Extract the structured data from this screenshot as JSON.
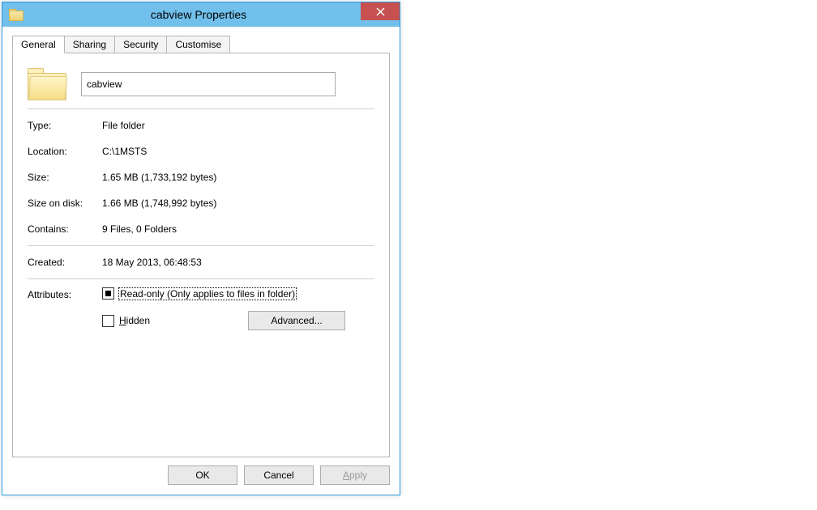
{
  "window": {
    "title": "cabview Properties"
  },
  "tabs": {
    "general": "General",
    "sharing": "Sharing",
    "security": "Security",
    "customise": "Customise"
  },
  "name_field": {
    "value": "cabview"
  },
  "props": {
    "type_label": "Type:",
    "type_value": "File folder",
    "location_label": "Location:",
    "location_value": "C:\\1MSTS",
    "size_label": "Size:",
    "size_value": "1.65 MB (1,733,192 bytes)",
    "sizeondisk_label": "Size on disk:",
    "sizeondisk_value": "1.66 MB (1,748,992 bytes)",
    "contains_label": "Contains:",
    "contains_value": "9 Files, 0 Folders",
    "created_label": "Created:",
    "created_value": "18 May 2013, 06:48:53",
    "attributes_label": "Attributes:"
  },
  "attributes": {
    "readonly_label": "Read-only (Only applies to files in folder)",
    "readonly_state": "mixed",
    "hidden_label_pre": "H",
    "hidden_label_rest": "idden",
    "hidden_state": "unchecked",
    "advanced_label": "Advanced..."
  },
  "buttons": {
    "ok": "OK",
    "cancel": "Cancel",
    "apply_pre": "A",
    "apply_rest": "pply"
  }
}
